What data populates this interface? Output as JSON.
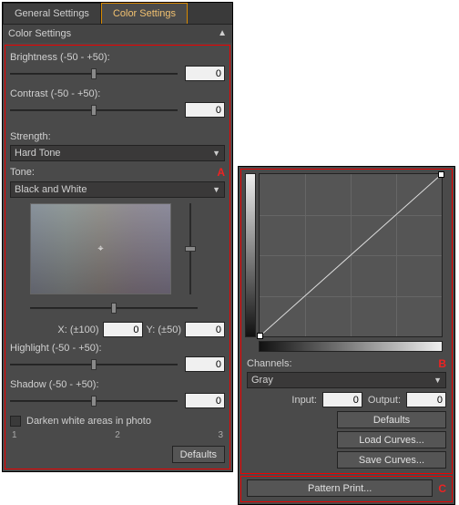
{
  "tabs": {
    "general": "General Settings",
    "color": "Color Settings"
  },
  "section_title": "Color Settings",
  "left": {
    "brightness_label": "Brightness (-50 - +50):",
    "brightness_value": "0",
    "contrast_label": "Contrast (-50 - +50):",
    "contrast_value": "0",
    "strength_label": "Strength:",
    "strength_value": "Hard Tone",
    "tone_label": "Tone:",
    "tone_marker": "A",
    "tone_value": "Black and White",
    "x_label": "X: (±100)",
    "x_value": "0",
    "y_label": "Y: (±50)",
    "y_value": "0",
    "highlight_label": "Highlight (-50 - +50):",
    "highlight_value": "0",
    "shadow_label": "Shadow (-50 - +50):",
    "shadow_value": "0",
    "darken_label": "Darken white areas in photo",
    "scale": {
      "a": "1",
      "b": "2",
      "c": "3"
    },
    "defaults_btn": "Defaults"
  },
  "right": {
    "channels_label": "Channels:",
    "channels_value": "Gray",
    "marker_b": "B",
    "input_label": "Input:",
    "input_value": "0",
    "output_label": "Output:",
    "output_value": "0",
    "defaults_btn": "Defaults",
    "load_btn": "Load Curves...",
    "save_btn": "Save Curves...",
    "pattern_btn": "Pattern Print...",
    "marker_c": "C"
  }
}
